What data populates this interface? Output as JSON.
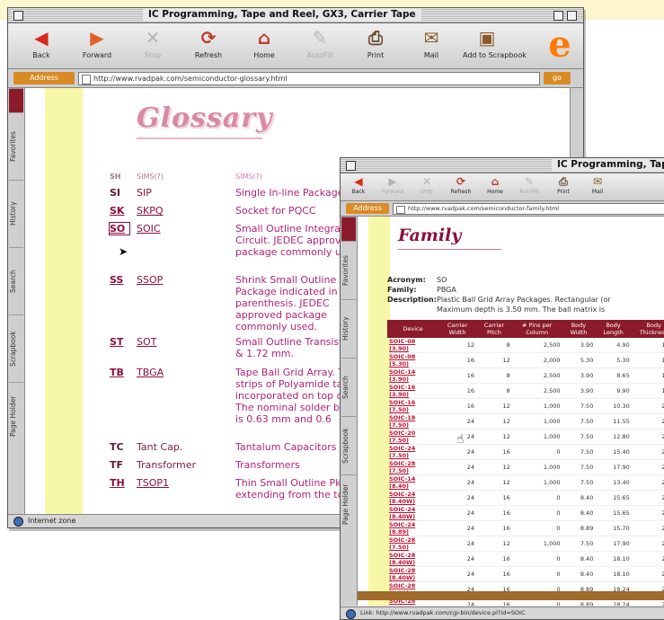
{
  "back_window": {
    "title": "IC Programming, Tape and Reel, GX3, Carrier Tape",
    "toolbar": [
      {
        "label": "Back",
        "icon": "back-arrow-icon",
        "glyph": "◀",
        "color": "#d9281e",
        "disabled": false
      },
      {
        "label": "Forward",
        "icon": "forward-arrow-icon",
        "glyph": "▶",
        "color": "#e0602a",
        "disabled": false
      },
      {
        "label": "Stop",
        "icon": "stop-icon",
        "glyph": "✕",
        "color": "#b5b5b5",
        "disabled": true
      },
      {
        "label": "Refresh",
        "icon": "refresh-icon",
        "glyph": "⟳",
        "color": "#c0392b",
        "disabled": false
      },
      {
        "label": "Home",
        "icon": "home-icon",
        "glyph": "⌂",
        "color": "#c0392b",
        "disabled": false
      },
      {
        "label": "AutoFill",
        "icon": "autofill-icon",
        "glyph": "✎",
        "color": "#b5b5b5",
        "disabled": true
      },
      {
        "label": "Print",
        "icon": "print-icon",
        "glyph": "⎙",
        "color": "#6a4a2a",
        "disabled": false
      },
      {
        "label": "Mail",
        "icon": "mail-icon",
        "glyph": "✉",
        "color": "#8a5a2a",
        "disabled": false
      },
      {
        "label": "Add to Scrapbook",
        "icon": "scrapbook-icon",
        "glyph": "▣",
        "color": "#8a5a2a",
        "disabled": false
      }
    ],
    "address_label": "Address",
    "url": "http://www.rvadpak.com/semiconductor-glossary.html",
    "go_label": "go",
    "sidebar_tabs": [
      "Favorites",
      "History",
      "Search",
      "Scrapbook",
      "Page Holder"
    ],
    "page_title": "Glossary",
    "glossary_rows": [
      {
        "code": "SH",
        "code_link": false,
        "pkg": "SIMS(?)",
        "pkg_link": false,
        "desc": "SIMS(?)"
      },
      {
        "code": "SI",
        "code_link": false,
        "pkg": "SIP",
        "pkg_link": false,
        "desc": "Single In-line Package"
      },
      {
        "code": "SK",
        "code_link": true,
        "pkg": "SKPQ",
        "pkg_link": true,
        "desc": "Socket for PQCC"
      },
      {
        "code": "SO",
        "code_link": true,
        "pkg": "SOIC",
        "pkg_link": true,
        "desc": "Small Outline Integrated Circuit. JEDEC approved package commonly used."
      },
      {
        "code": "SS",
        "code_link": true,
        "pkg": "SSOP",
        "pkg_link": true,
        "desc": "Shrink Small Outline Package indicated in the parenthesis. JEDEC approved package commonly used."
      },
      {
        "code": "ST",
        "code_link": true,
        "pkg": "SOT",
        "pkg_link": true,
        "desc": "Small Outline Transistor 1.32 & 1.72 mm."
      },
      {
        "code": "TB",
        "code_link": true,
        "pkg": "TBGA",
        "pkg_link": true,
        "desc": "Tape Ball Grid Array. The strips of Polyamide tape incorporated on top of the. The nominal solder ball balls is 0.63 mm and 0.6"
      },
      {
        "code": "TC",
        "code_link": false,
        "pkg": "Tant Cap.",
        "pkg_link": false,
        "desc": "Tantalum Capacitors"
      },
      {
        "code": "TF",
        "code_link": false,
        "pkg": "Transformer",
        "pkg_link": false,
        "desc": "Transformers"
      },
      {
        "code": "TH",
        "code_link": true,
        "pkg": "TSOP1",
        "pkg_link": true,
        "desc": "Thin Small Outline Pkg. extending from the top"
      }
    ],
    "status": "Internet zone"
  },
  "front_window": {
    "title": "IC Programming, Tape and Reel, GX3, Carrier Tape",
    "toolbar": [
      {
        "label": "Back",
        "icon": "back-arrow-icon",
        "glyph": "◀",
        "color": "#d9281e",
        "disabled": false
      },
      {
        "label": "Forward",
        "icon": "forward-arrow-icon",
        "glyph": "▶",
        "color": "#b5b5b5",
        "disabled": true
      },
      {
        "label": "Stop",
        "icon": "stop-icon",
        "glyph": "✕",
        "color": "#b5b5b5",
        "disabled": true
      },
      {
        "label": "Refresh",
        "icon": "refresh-icon",
        "glyph": "⟳",
        "color": "#c0392b",
        "disabled": false
      },
      {
        "label": "Home",
        "icon": "home-icon",
        "glyph": "⌂",
        "color": "#c0392b",
        "disabled": false
      },
      {
        "label": "AutoFill",
        "icon": "autofill-icon",
        "glyph": "✎",
        "color": "#b5b5b5",
        "disabled": true
      },
      {
        "label": "Print",
        "icon": "print-icon",
        "glyph": "⎙",
        "color": "#6a4a2a",
        "disabled": false
      },
      {
        "label": "Mail",
        "icon": "mail-icon",
        "glyph": "✉",
        "color": "#8a5a2a",
        "disabled": false
      }
    ],
    "address_label": "Address",
    "url": "http://www.rvadpak.com/semiconductor-family.html",
    "sidebar_tabs": [
      "Favorites",
      "History",
      "Search",
      "Scrapbook",
      "Page Holder"
    ],
    "page_title": "Family",
    "meta": [
      {
        "label": "Acronym:",
        "value": "SO"
      },
      {
        "label": "Family:",
        "value": "PBGA"
      },
      {
        "label": "Description:",
        "value": "Plastic Ball Grid Array Packages. Rectangular (or"
      },
      {
        "label": "",
        "value": "Maximum depth is 3.50 mm. The ball matrix is"
      }
    ],
    "table_headers": [
      "Device",
      "Carrier Width",
      "Carrier Pitch",
      "# Pins per Column",
      "Body Width",
      "Body Length",
      "Body Thickness",
      ""
    ],
    "table_rows": [
      [
        "SOIC-08 (3.90)",
        "12",
        "8",
        "2,500",
        "3.90",
        "4.90",
        "1.65",
        "1"
      ],
      [
        "SOIC-08 (5.30)",
        "16",
        "12",
        "2,000",
        "5.30",
        "5.30",
        "1.85",
        "1"
      ],
      [
        "SOIC-14 (3.90)",
        "16",
        "8",
        "2,500",
        "3.90",
        "8.65",
        "1.65",
        "1"
      ],
      [
        "SOIC-16 (3.90)",
        "16",
        "8",
        "2,500",
        "3.90",
        "9.90",
        "1.65",
        "1"
      ],
      [
        "SOIC-16 (7.50)",
        "16",
        "12",
        "1,000",
        "7.50",
        "10.30",
        "2.35",
        "1"
      ],
      [
        "SOIC-18 (7.50)",
        "24",
        "12",
        "1,000",
        "7.50",
        "11.55",
        "2.35",
        "1"
      ],
      [
        "SOIC-20 (7.50)",
        "24",
        "12",
        "1,000",
        "7.50",
        "12.80",
        "2.35",
        "1"
      ],
      [
        "SOIC-24 (7.50)",
        "24",
        "16",
        "0",
        "7.50",
        "15.40",
        "2.35",
        "1"
      ],
      [
        "SOIC-28 (7.50)",
        "24",
        "12",
        "1,000",
        "7.50",
        "17.90",
        "2.35",
        "1"
      ],
      [
        "SOIC-14 (8.40)",
        "24",
        "12",
        "1,000",
        "7.50",
        "13.40",
        "2.50",
        "1"
      ],
      [
        "SOIC-24 (8.40W)",
        "24",
        "16",
        "0",
        "8.40",
        "15.65",
        "2.50",
        "1"
      ],
      [
        "SOIC-24 (8.40W)",
        "24",
        "16",
        "0",
        "8.40",
        "15.65",
        "2.50",
        "1"
      ],
      [
        "SOIC-24 (8.89)",
        "24",
        "16",
        "0",
        "8.89",
        "15.70",
        "2.50",
        "1"
      ],
      [
        "SOIC-28 (7.50)",
        "24",
        "12",
        "1,000",
        "7.50",
        "17.90",
        "2.35",
        "1"
      ],
      [
        "SOIC-28 (8.40W)",
        "24",
        "16",
        "0",
        "8.40",
        "18.10",
        "2.50",
        "1"
      ],
      [
        "SOIC-28 (8.40W)",
        "24",
        "16",
        "0",
        "8.40",
        "18.10",
        "2.50",
        "1"
      ],
      [
        "SOIC-28 (8.89)",
        "24",
        "16",
        "0",
        "8.89",
        "18.24",
        "2.50",
        "1"
      ],
      [
        "SOIC-28 (8.89)",
        "24",
        "16",
        "0",
        "8.89",
        "18.24",
        "2.50",
        "1"
      ]
    ],
    "status": "Link: http://www.rvadpak.com/cgi-bin/device.pl?id=SOIC"
  },
  "colors": {
    "accent": "#8b1a2a",
    "link": "#c01030",
    "text_pink": "#b0237a",
    "address_orange": "#d98b25",
    "page_strip": "#f7f7a8"
  }
}
